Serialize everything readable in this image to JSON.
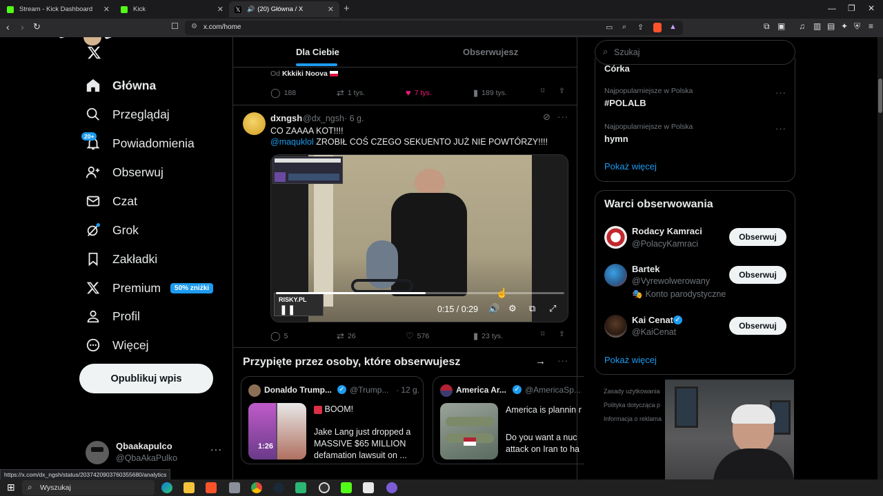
{
  "browser": {
    "tabs": [
      {
        "label": "Stream - Kick Dashboard",
        "color": "#53fc18"
      },
      {
        "label": "Kick",
        "color": "#53fc18"
      },
      {
        "label": "(20) Główna / X",
        "color": "#ffffff"
      }
    ],
    "url": "x.com/home",
    "status_url": "https://x.com/dx_ngsh/status/2037420903760355680/analytics"
  },
  "sidebar": {
    "items": [
      {
        "label": "Główna",
        "icon": "home-icon"
      },
      {
        "label": "Przeglądaj",
        "icon": "search-icon"
      },
      {
        "label": "Powiadomienia",
        "icon": "bell-icon"
      },
      {
        "label": "Obserwuj",
        "icon": "follow-icon"
      },
      {
        "label": "Czat",
        "icon": "mail-icon"
      },
      {
        "label": "Grok",
        "icon": "grok-icon"
      },
      {
        "label": "Zakładki",
        "icon": "bookmark-icon"
      },
      {
        "label": "Premium",
        "icon": "x-icon"
      },
      {
        "label": "Profil",
        "icon": "profile-icon"
      },
      {
        "label": "Więcej",
        "icon": "more-icon"
      }
    ],
    "notif_badge": "20+",
    "premium_badge": "50% zniżki",
    "post_button": "Opublikuj wpis",
    "account_name": "Qbaakapulco",
    "account_handle": "@QbaAkaPulko"
  },
  "timeline": {
    "tab_for_you": "Dla Ciebie",
    "tab_following": "Obserwujesz",
    "prev_post": {
      "from_label": "Od",
      "from_name": "Kkkiki Noova",
      "replies": "188",
      "reposts": "1 tys.",
      "likes": "7 tys.",
      "views": "189 tys."
    },
    "post": {
      "name": "dxngsh",
      "handle": "@dx_ngsh",
      "time": "· 6 g.",
      "line1": "CO ZAAAA KOT!!!!",
      "mention": "@maquklol",
      "line2": "ZROBIŁ COŚ CZEGO SEKUENTO JUŻ NIE POWTÓRZY!!!!",
      "video_time": "0:15 / 0:29",
      "video_progress": 0.52,
      "overlay_logo": "RISKY.PL",
      "replies": "5",
      "reposts": "26",
      "likes": "576",
      "views": "23 tys."
    },
    "pinned_header": "Przypięte przez osoby, które obserwujesz",
    "pinned": [
      {
        "name": "Donaldo Trump...",
        "handle": "@Trump...",
        "time": "· 12 g.",
        "headline": "BOOM!",
        "text": "Jake Lang just dropped a MASSIVE $65 MILLION defamation lawsuit on ...",
        "duration": "1:26"
      },
      {
        "name": "America Ar...",
        "handle": "@AmericaSp...",
        "headline": "America is plannin nuclear attack on I",
        "text": "Do you want a nuc attack on Iran to ha"
      }
    ]
  },
  "right": {
    "search_placeholder": "Szukaj",
    "trends_top_cut": "Córka",
    "trends": [
      {
        "meta": "Najpopularniejsze w Polska",
        "name": "#POLALB"
      },
      {
        "meta": "Najpopularniejsze w Polska",
        "name": "hymn"
      }
    ],
    "show_more": "Pokaż więcej",
    "who_to_follow_title": "Warci obserwowania",
    "who_to_follow": [
      {
        "name": "Rodacy Kamraci",
        "handle": "@PolacyKamraci",
        "note": ""
      },
      {
        "name": "Bartek",
        "handle": "@Vyrewolwerowany",
        "note": "Konto parodystyczne"
      },
      {
        "name": "Kai Cenat",
        "handle": "@KaiCenat",
        "note": ""
      }
    ],
    "follow_label": "Obserwuj",
    "footer": [
      "Zasady użytkowania",
      "Polityka dotycząca p",
      "Informacja o reklama"
    ]
  },
  "taskbar": {
    "search_label": "Wyszukaj"
  }
}
